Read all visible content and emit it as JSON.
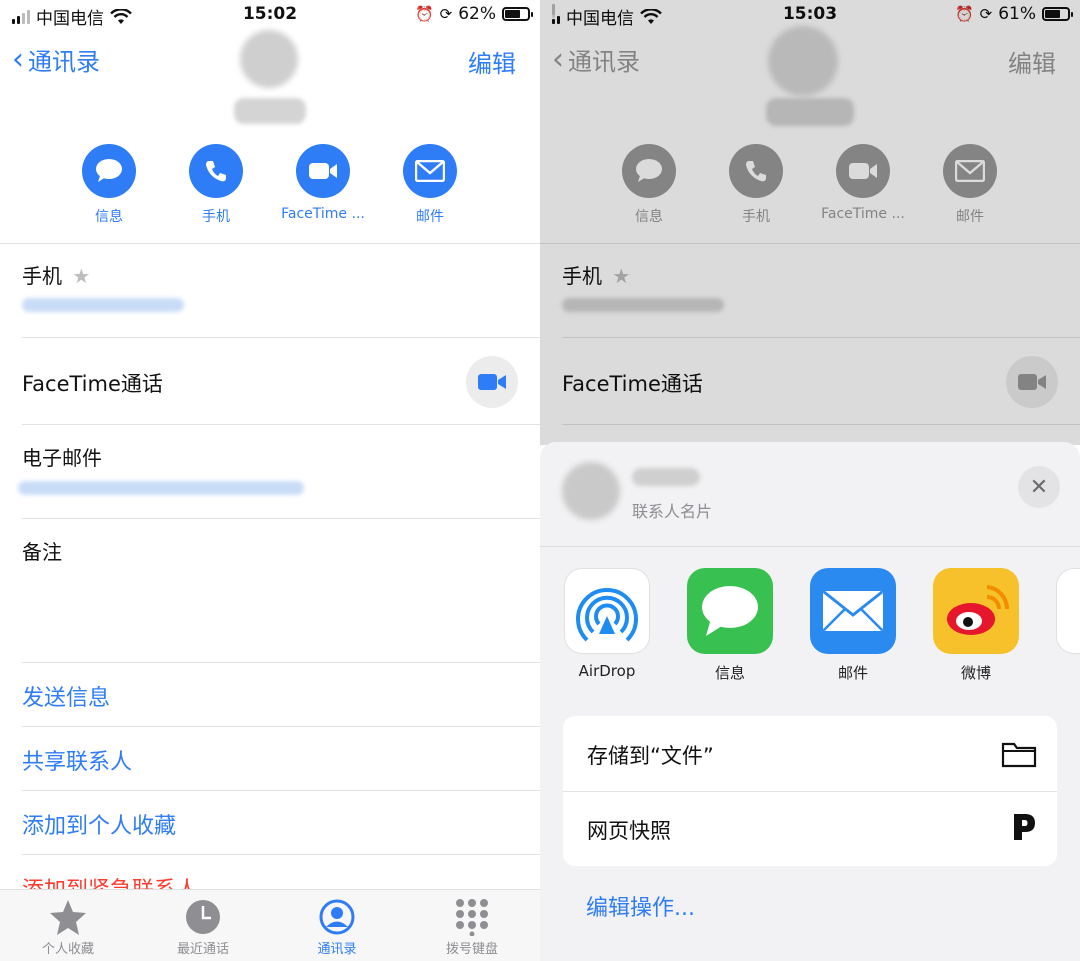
{
  "left": {
    "status": {
      "carrier": "中国电信",
      "time": "15:02",
      "battery": "62%",
      "battery_level": 0.62
    },
    "nav": {
      "back": "通讯录",
      "edit": "编辑"
    },
    "actions": [
      {
        "label": "信息",
        "icon": "message-icon"
      },
      {
        "label": "手机",
        "icon": "phone-icon"
      },
      {
        "label": "FaceTime ...",
        "icon": "video-icon"
      },
      {
        "label": "邮件",
        "icon": "mail-icon"
      }
    ],
    "fields": {
      "phone_label": "手机",
      "facetime_label": "FaceTime通话",
      "email_label": "电子邮件",
      "notes_label": "备注"
    },
    "links": {
      "send_message": "发送信息",
      "share_contact": "共享联系人",
      "add_favorites": "添加到个人收藏",
      "add_emergency": "添加到紧急联系人"
    },
    "tabs": [
      {
        "label": "个人收藏",
        "icon": "star-icon"
      },
      {
        "label": "最近通话",
        "icon": "clock-icon"
      },
      {
        "label": "通讯录",
        "icon": "contacts-icon",
        "active": true
      },
      {
        "label": "拨号键盘",
        "icon": "keypad-icon"
      }
    ]
  },
  "right": {
    "status": {
      "carrier": "中国电信",
      "time": "15:03",
      "battery": "61%",
      "battery_level": 0.61
    },
    "nav": {
      "back": "通讯录",
      "edit": "编辑"
    },
    "actions": [
      {
        "label": "信息"
      },
      {
        "label": "手机"
      },
      {
        "label": "FaceTime ..."
      },
      {
        "label": "邮件"
      }
    ],
    "fields": {
      "phone_label": "手机",
      "facetime_label": "FaceTime通话"
    },
    "share_sheet": {
      "subtitle": "联系人名片",
      "apps": [
        {
          "label": "AirDrop",
          "icon": "airdrop-icon"
        },
        {
          "label": "信息",
          "icon": "messages-app-icon"
        },
        {
          "label": "邮件",
          "icon": "mail-app-icon"
        },
        {
          "label": "微博",
          "icon": "weibo-app-icon"
        }
      ],
      "save_to_files": "存储到“文件”",
      "web_snapshot": "网页快照",
      "edit_actions": "编辑操作..."
    }
  },
  "colors": {
    "accent": "#2f7df6",
    "destructive": "#ff3b30",
    "messages_green": "#38c150",
    "mail_blue": "#2a8af0",
    "weibo_yellow": "#f6c12a"
  }
}
